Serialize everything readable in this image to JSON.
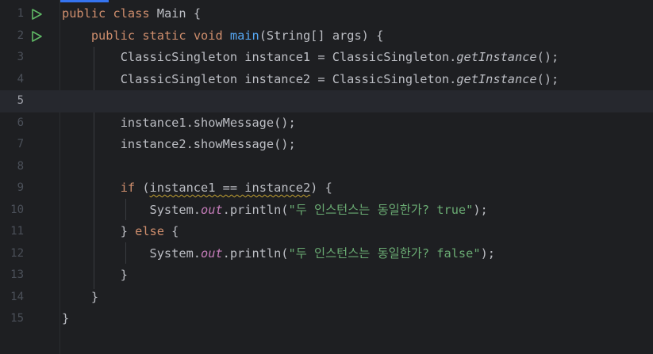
{
  "editor": {
    "accent_color": "#3574f0",
    "colors": {
      "keyword": "#cf8e6d",
      "method_declaration": "#56a8f5",
      "static_field": "#c77dbb",
      "string": "#6aab73",
      "default_text": "#bcbec4",
      "warning_underline": "#c5a332"
    },
    "gutter_icon": "run-icon",
    "current_line": 5,
    "lines": [
      {
        "number": "1",
        "tokens": [
          "public",
          "class",
          "Main {"
        ]
      },
      {
        "number": "2",
        "tokens": [
          "public",
          "static",
          "void",
          "main",
          "(String[] args) {"
        ]
      },
      {
        "number": "3",
        "tokens": [
          "ClassicSingleton instance1 = ClassicSingleton.",
          "getInstance",
          "();"
        ]
      },
      {
        "number": "4",
        "tokens": [
          "ClassicSingleton instance2 = ClassicSingleton.",
          "getInstance",
          "();"
        ]
      },
      {
        "number": "5",
        "tokens": []
      },
      {
        "number": "6",
        "tokens": [
          "instance1.showMessage();"
        ]
      },
      {
        "number": "7",
        "tokens": [
          "instance2.showMessage();"
        ]
      },
      {
        "number": "8",
        "tokens": []
      },
      {
        "number": "9",
        "tokens": [
          "if",
          "(",
          "instance1 == instance2",
          ") {"
        ]
      },
      {
        "number": "10",
        "tokens": [
          "System.",
          "out",
          ".println(",
          "\"두 인스턴스는 동일한가? true\"",
          ");"
        ]
      },
      {
        "number": "11",
        "tokens": [
          "} ",
          "else",
          " {"
        ]
      },
      {
        "number": "12",
        "tokens": [
          "System.",
          "out",
          ".println(",
          "\"두 인스턴스는 동일한가? false\"",
          ");"
        ]
      },
      {
        "number": "13",
        "tokens": [
          "}"
        ]
      },
      {
        "number": "14",
        "tokens": [
          "}"
        ]
      },
      {
        "number": "15",
        "tokens": [
          "}"
        ]
      }
    ]
  }
}
